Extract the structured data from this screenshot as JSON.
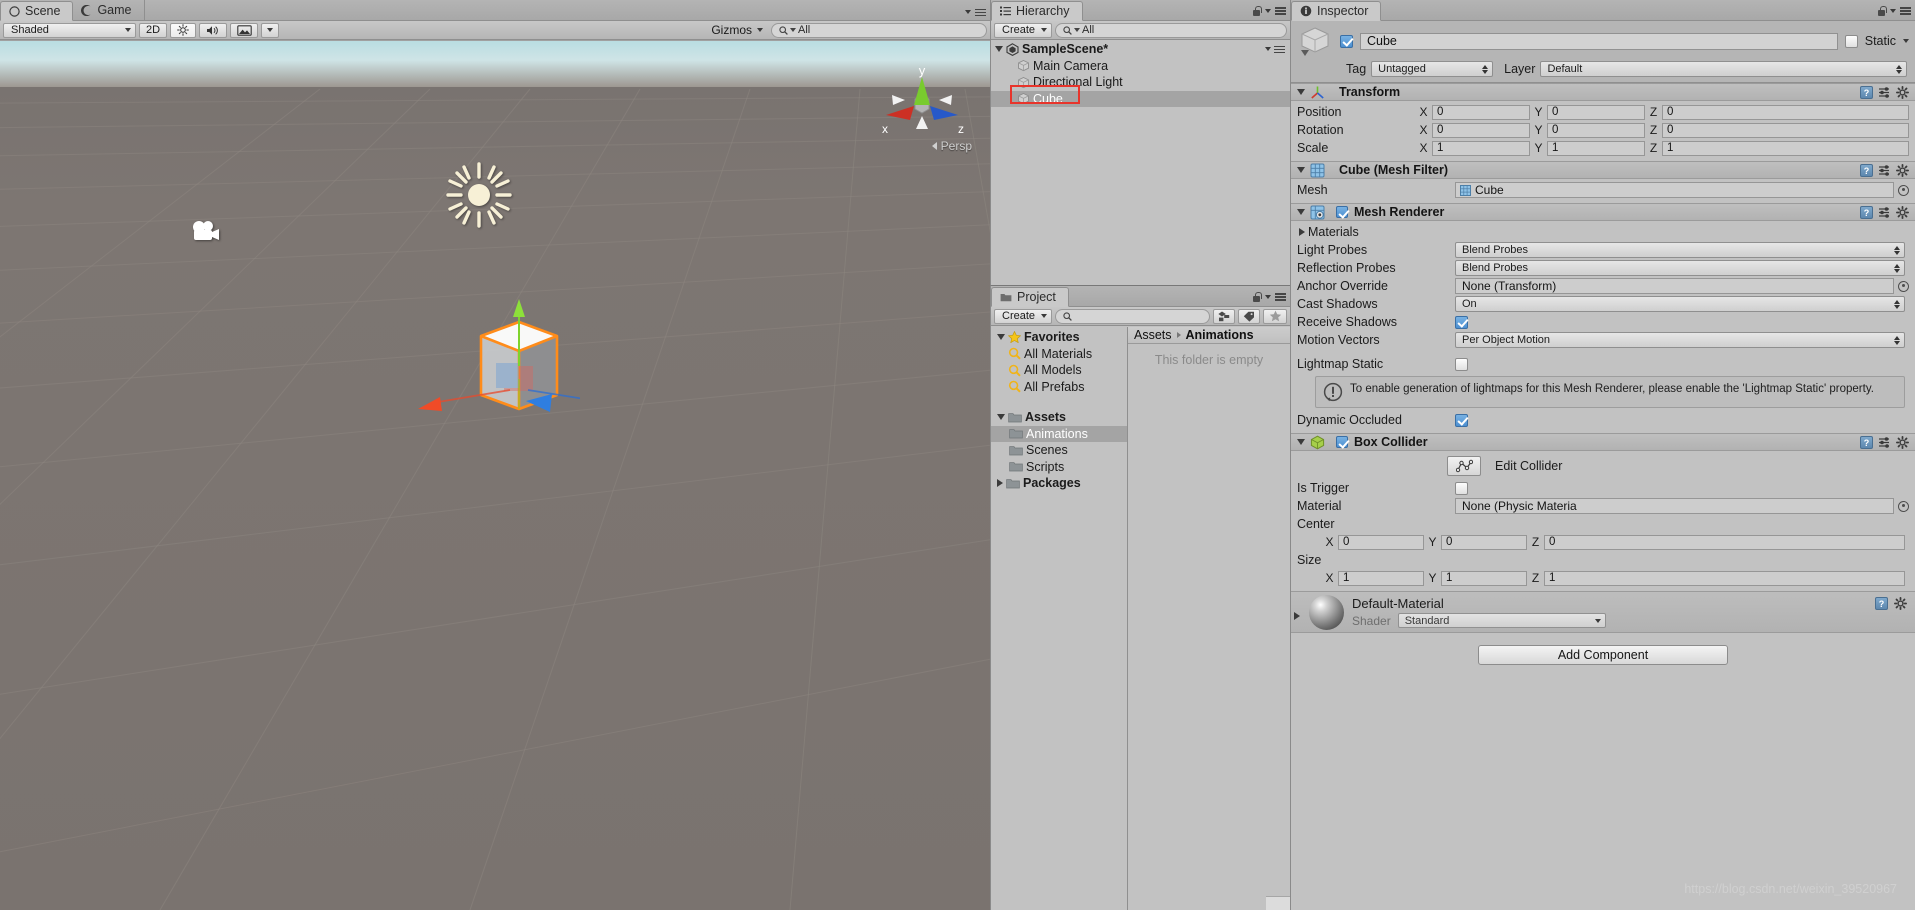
{
  "scene": {
    "tabs": [
      {
        "label": "Scene",
        "icon": "scene-icon",
        "active": true
      },
      {
        "label": "Game",
        "icon": "game-icon",
        "active": false
      }
    ],
    "toolbar": {
      "draw_mode": "Shaded",
      "mode_2d": "2D",
      "lighting_icon": "sun-icon",
      "audio_icon": "speaker-icon",
      "effects_icon": "image-icon",
      "gizmos_label": "Gizmos",
      "search_placeholder": "All",
      "search_value": "All"
    },
    "viewport": {
      "axis_labels": {
        "x": "x",
        "y": "y",
        "z": "z"
      },
      "projection_label": "Persp",
      "gizmos": [
        "camera-gizmo",
        "directional-light-gizmo",
        "selected-cube"
      ]
    }
  },
  "hierarchy": {
    "tab_label": "Hierarchy",
    "create_label": "Create",
    "search_value": "All",
    "scene_name": "SampleScene*",
    "items": [
      {
        "label": "Main Camera",
        "selected": false
      },
      {
        "label": "Directional Light",
        "selected": false
      },
      {
        "label": "Cube",
        "selected": true,
        "highlighted": true
      }
    ]
  },
  "project": {
    "tab_label": "Project",
    "create_label": "Create",
    "search_value": "",
    "favorites_label": "Favorites",
    "favorites": [
      "All Materials",
      "All Models",
      "All Prefabs"
    ],
    "assets_label": "Assets",
    "folders": [
      {
        "label": "Animations",
        "selected": true
      },
      {
        "label": "Scenes",
        "selected": false
      },
      {
        "label": "Scripts",
        "selected": false
      }
    ],
    "packages_label": "Packages",
    "breadcrumb": [
      "Assets",
      "Animations"
    ],
    "empty_message": "This folder is empty"
  },
  "inspector": {
    "tab_label": "Inspector",
    "object_name": "Cube",
    "object_enabled": true,
    "static_label": "Static",
    "static_checked": false,
    "tag_label": "Tag",
    "tag_value": "Untagged",
    "layer_label": "Layer",
    "layer_value": "Default",
    "transform": {
      "title": "Transform",
      "rows": [
        {
          "label": "Position",
          "x": "0",
          "y": "0",
          "z": "0"
        },
        {
          "label": "Rotation",
          "x": "0",
          "y": "0",
          "z": "0"
        },
        {
          "label": "Scale",
          "x": "1",
          "y": "1",
          "z": "1"
        }
      ]
    },
    "mesh_filter": {
      "title": "Cube (Mesh Filter)",
      "mesh_label": "Mesh",
      "mesh_value": "Cube"
    },
    "mesh_renderer": {
      "title": "Mesh Renderer",
      "enabled": true,
      "materials_label": "Materials",
      "light_probes_label": "Light Probes",
      "light_probes_value": "Blend Probes",
      "reflection_probes_label": "Reflection Probes",
      "reflection_probes_value": "Blend Probes",
      "anchor_override_label": "Anchor Override",
      "anchor_override_value": "None (Transform)",
      "cast_shadows_label": "Cast Shadows",
      "cast_shadows_value": "On",
      "receive_shadows_label": "Receive Shadows",
      "receive_shadows_checked": true,
      "motion_vectors_label": "Motion Vectors",
      "motion_vectors_value": "Per Object Motion",
      "lightmap_static_label": "Lightmap Static",
      "lightmap_static_checked": false,
      "help_text": "To enable generation of lightmaps for this Mesh Renderer, please enable the 'Lightmap Static' property.",
      "dynamic_occluded_label": "Dynamic Occluded",
      "dynamic_occluded_checked": true
    },
    "box_collider": {
      "title": "Box Collider",
      "enabled": true,
      "edit_collider_label": "Edit Collider",
      "is_trigger_label": "Is Trigger",
      "is_trigger_checked": false,
      "material_label": "Material",
      "material_value": "None (Physic Materia",
      "center_label": "Center",
      "center": {
        "x": "0",
        "y": "0",
        "z": "0"
      },
      "size_label": "Size",
      "size": {
        "x": "1",
        "y": "1",
        "z": "1"
      }
    },
    "material": {
      "name": "Default-Material",
      "shader_label": "Shader",
      "shader_value": "Standard"
    },
    "add_component_label": "Add Component"
  },
  "watermark": "https://blog.csdn.net/weixin_39520967",
  "colors": {
    "chrome": "#c2c2c2",
    "selection_red": "#e8342b",
    "axis_x": "#d3372c",
    "axis_y": "#7fd32c",
    "axis_z": "#2c6fd3",
    "selection_outline": "#ff8c1a"
  }
}
